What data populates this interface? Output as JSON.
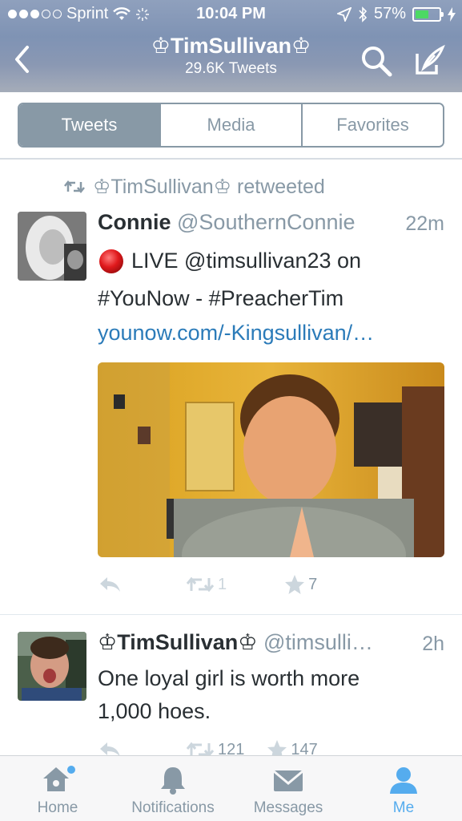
{
  "status_bar": {
    "carrier": "Sprint",
    "time": "10:04 PM",
    "battery": "57%",
    "battery_level": 0.57
  },
  "header": {
    "title": "♔TimSullivan♔",
    "subtitle": "29.6K Tweets",
    "icons": [
      "back-chevron-icon",
      "search-icon",
      "compose-icon"
    ]
  },
  "tabs": {
    "items": [
      "Tweets",
      "Media",
      "Favorites"
    ],
    "selected": "Tweets"
  },
  "tweets": [
    {
      "retweet_label": "♔TimSullivan♔ retweeted",
      "name": "Connie",
      "handle": "@SouthernConnie",
      "time": "22m",
      "text_line1": " LIVE @timsullivan23 on",
      "text_line2": "#YouNow - #PreacherTim",
      "link": "younow.com/-Kingsullivan/…",
      "retweets": "1",
      "favorites": "7"
    },
    {
      "name": "♔TimSullivan♔",
      "handle": "@timsulli…",
      "time": "2h",
      "text_line1": "One loyal girl is worth more",
      "text_line2": "1,000 hoes.",
      "retweets": "121",
      "favorites": "147"
    }
  ],
  "tabbar": {
    "home": "Home",
    "notifications": "Notifications",
    "messages": "Messages",
    "me": "Me",
    "active": "Me"
  },
  "colors": {
    "accent": "#55acee",
    "link": "#2b7bb9",
    "muted": "#8899a6",
    "live_dot": "#e0191c"
  }
}
